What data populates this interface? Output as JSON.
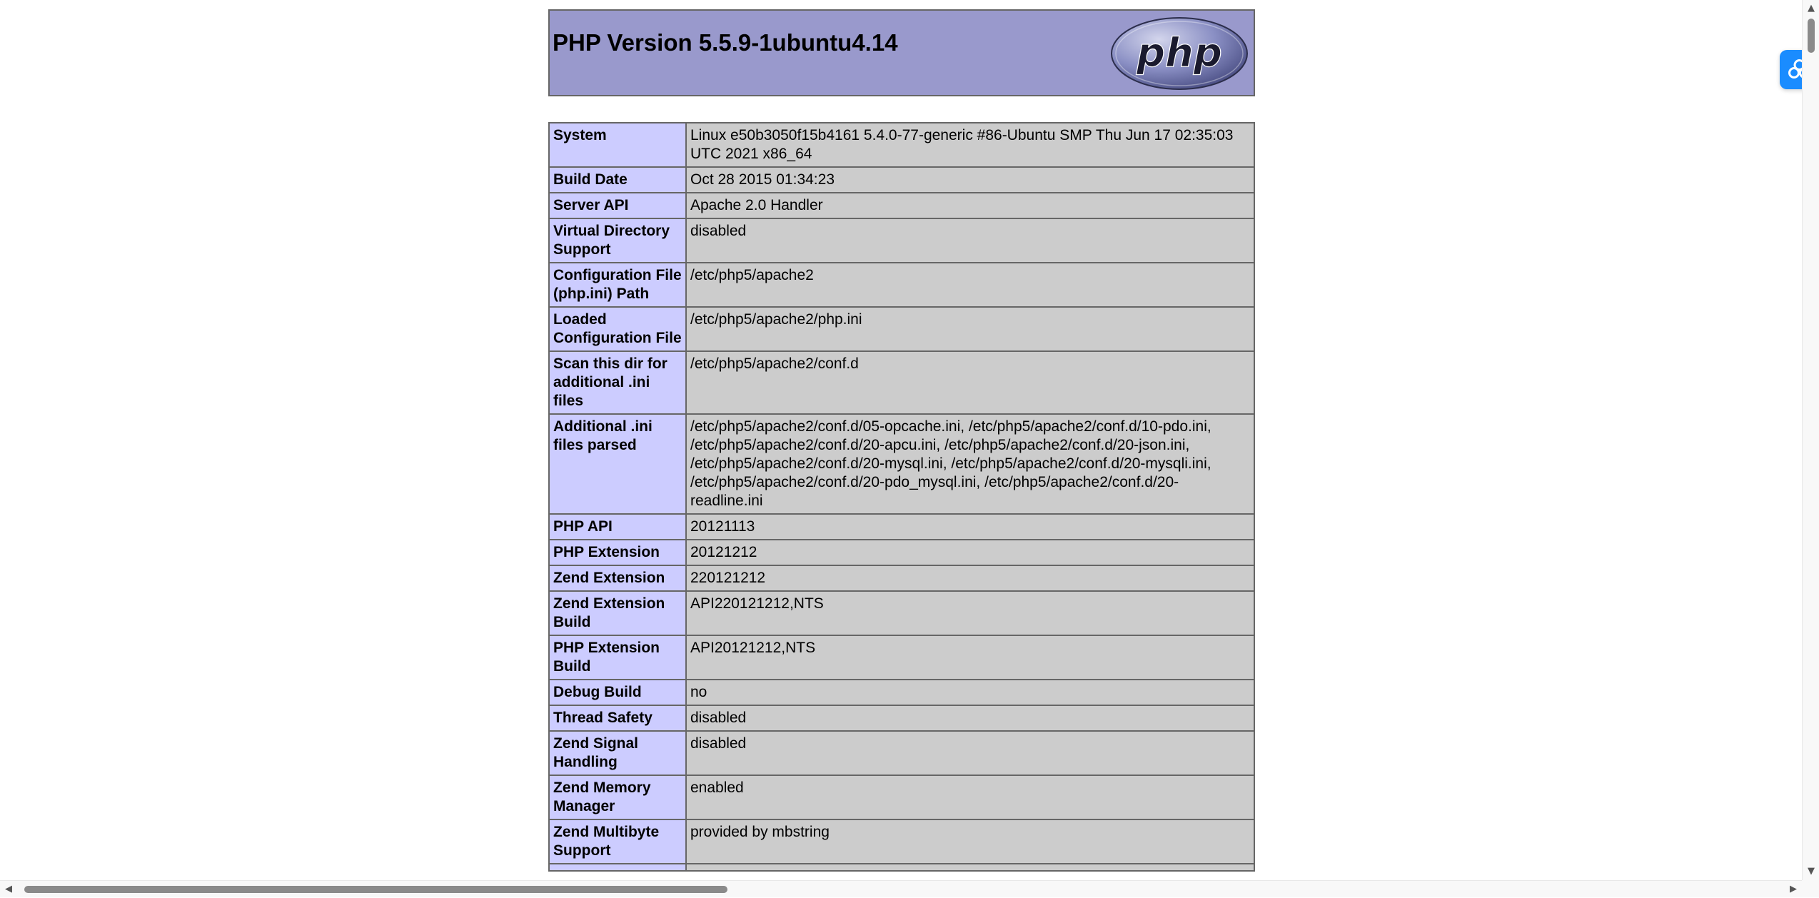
{
  "header": {
    "title": "PHP Version 5.5.9-1ubuntu4.14",
    "logo_text": "php",
    "logo_icon": "php-logo-icon"
  },
  "info_rows": [
    {
      "key": "System",
      "value": "Linux e50b3050f15b4161 5.4.0-77-generic #86-Ubuntu SMP Thu Jun 17 02:35:03 UTC 2021 x86_64"
    },
    {
      "key": "Build Date",
      "value": "Oct 28 2015 01:34:23"
    },
    {
      "key": "Server API",
      "value": "Apache 2.0 Handler"
    },
    {
      "key": "Virtual Directory Support",
      "value": "disabled"
    },
    {
      "key": "Configuration File (php.ini) Path",
      "value": "/etc/php5/apache2"
    },
    {
      "key": "Loaded Configuration File",
      "value": "/etc/php5/apache2/php.ini"
    },
    {
      "key": "Scan this dir for additional .ini files",
      "value": "/etc/php5/apache2/conf.d"
    },
    {
      "key": "Additional .ini files parsed",
      "value": "/etc/php5/apache2/conf.d/05-opcache.ini, /etc/php5/apache2/conf.d/10-pdo.ini, /etc/php5/apache2/conf.d/20-apcu.ini, /etc/php5/apache2/conf.d/20-json.ini, /etc/php5/apache2/conf.d/20-mysql.ini, /etc/php5/apache2/conf.d/20-mysqli.ini, /etc/php5/apache2/conf.d/20-pdo_mysql.ini, /etc/php5/apache2/conf.d/20-readline.ini"
    },
    {
      "key": "PHP API",
      "value": "20121113"
    },
    {
      "key": "PHP Extension",
      "value": "20121212"
    },
    {
      "key": "Zend Extension",
      "value": "220121212"
    },
    {
      "key": "Zend Extension Build",
      "value": "API220121212,NTS"
    },
    {
      "key": "PHP Extension Build",
      "value": "API20121212,NTS"
    },
    {
      "key": "Debug Build",
      "value": "no"
    },
    {
      "key": "Thread Safety",
      "value": "disabled"
    },
    {
      "key": "Zend Signal Handling",
      "value": "disabled"
    },
    {
      "key": "Zend Memory Manager",
      "value": "enabled"
    },
    {
      "key": "Zend Multibyte Support",
      "value": "provided by mbstring"
    },
    {
      "key": "",
      "value": ""
    }
  ],
  "colors": {
    "header_bg": "#9999cc",
    "key_bg": "#ccccff",
    "value_bg": "#cccccc",
    "border": "#666666",
    "float_button": "#1a8cff"
  },
  "scrollbars": {
    "up_arrow": "▲",
    "down_arrow": "▼",
    "left_arrow": "◀",
    "right_arrow": "▶"
  },
  "float_button": {
    "icon": "cloud-link-icon"
  }
}
